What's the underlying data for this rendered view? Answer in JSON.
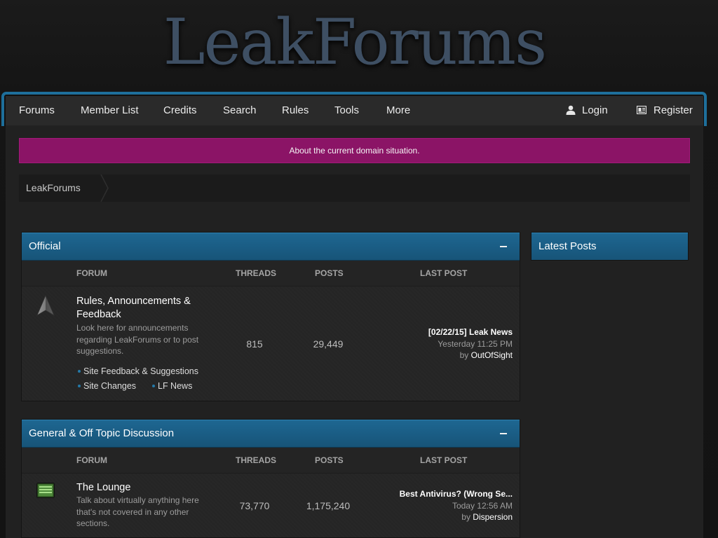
{
  "site": {
    "logo": "LeakForums"
  },
  "nav": {
    "items": [
      {
        "label": "Forums"
      },
      {
        "label": "Member List"
      },
      {
        "label": "Credits"
      },
      {
        "label": "Search"
      },
      {
        "label": "Rules"
      },
      {
        "label": "Tools"
      },
      {
        "label": "More"
      }
    ],
    "login": {
      "label": "Login",
      "icon": "user-icon"
    },
    "register": {
      "label": "Register",
      "icon": "register-icon"
    }
  },
  "notice": {
    "text": "About the current domain situation."
  },
  "breadcrumb": {
    "items": [
      "LeakForums"
    ]
  },
  "categories": [
    {
      "title": "Official",
      "collapse_icon": "collapse-icon",
      "columns": {
        "forum": "FORUM",
        "threads": "THREADS",
        "posts": "POSTS",
        "last_post": "LAST POST"
      },
      "forums": [
        {
          "icon": "arrow-icon",
          "title": "Rules, Announcements & Feedback",
          "description": "Look here for announcements regarding LeakForums or to post suggestions.",
          "threads": "815",
          "posts": "29,449",
          "last_post": {
            "title": "[02/22/15] Leak News",
            "time": "Yesterday 11:25 PM",
            "by": "by",
            "user": "OutOfSight"
          },
          "subforums": [
            "Site Feedback & Suggestions",
            "Site Changes",
            "LF News"
          ]
        }
      ]
    },
    {
      "title": "General & Off Topic Discussion",
      "collapse_icon": "collapse-icon",
      "columns": {
        "forum": "FORUM",
        "threads": "THREADS",
        "posts": "POSTS",
        "last_post": "LAST POST"
      },
      "forums": [
        {
          "icon": "monitor-icon",
          "title": "The Lounge",
          "description": "Talk about virtually anything here that's not covered in any other sections.",
          "threads": "73,770",
          "posts": "1,175,240",
          "last_post": {
            "title": "Best Antivirus? (Wrong Se...",
            "time": "Today 12:56 AM",
            "by": "by",
            "user": "Dispersion"
          }
        }
      ]
    }
  ],
  "sidebar": {
    "title": "Latest Posts"
  },
  "colors": {
    "accent": "#1e6f9b",
    "notice": "#8b1466",
    "category_header": "#1a5c84",
    "background": "#212121"
  }
}
